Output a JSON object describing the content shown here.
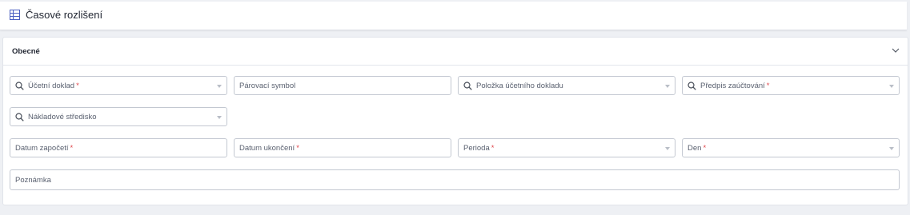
{
  "header": {
    "title": "Časové rozlišení"
  },
  "section": {
    "label": "Obecné"
  },
  "fields": {
    "ucetni_doklad": {
      "label": "Účetní doklad",
      "required": "*"
    },
    "parovaci_symbol": {
      "label": "Párovací symbol"
    },
    "polozka": {
      "label": "Položka účetního dokladu"
    },
    "predpis": {
      "label": "Předpis zaúčtování",
      "required": "*"
    },
    "stredisko": {
      "label": "Nákladové středisko"
    },
    "datum_zapoceti": {
      "label": "Datum započetí",
      "required": "*"
    },
    "datum_ukonceni": {
      "label": "Datum ukončení",
      "required": "*"
    },
    "perioda": {
      "label": "Perioda",
      "required": "*"
    },
    "den": {
      "label": "Den",
      "required": "*"
    },
    "poznamka": {
      "label": "Poznámka"
    }
  },
  "colors": {
    "required": "#e0474c",
    "icon": "#4a5fc1",
    "border": "#c3c8d1"
  }
}
